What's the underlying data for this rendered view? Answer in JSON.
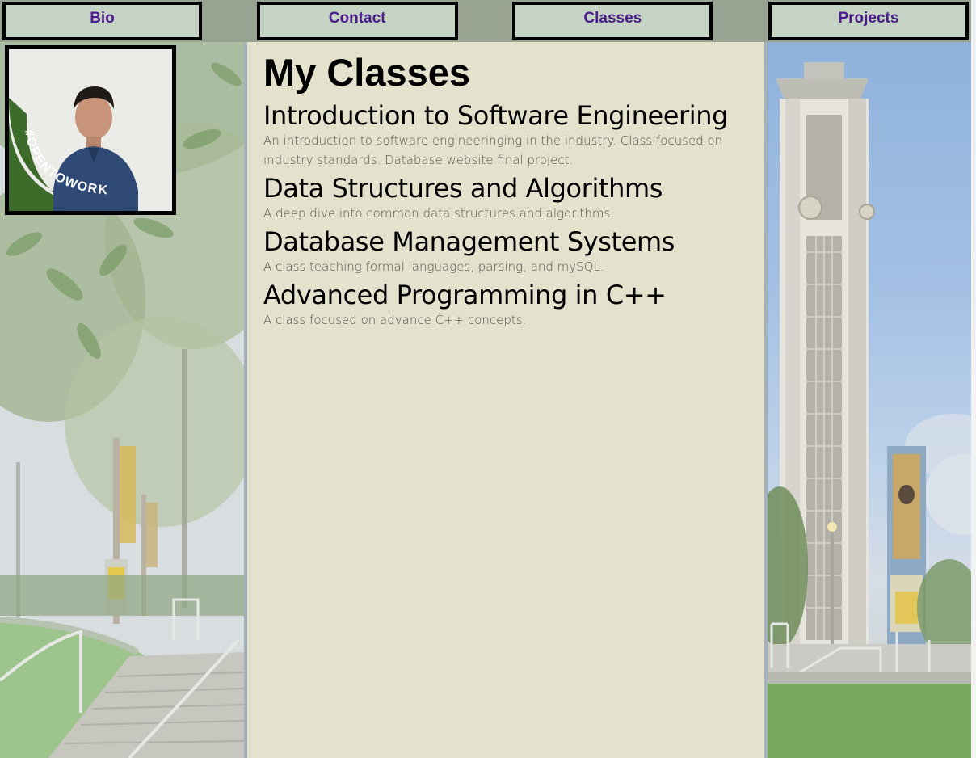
{
  "nav": {
    "items": [
      {
        "label": "Bio"
      },
      {
        "label": "Contact"
      },
      {
        "label": "Classes"
      },
      {
        "label": "Projects"
      }
    ]
  },
  "profile": {
    "badge_text": "#OPENTOWORK"
  },
  "main": {
    "title": "My Classes",
    "classes": [
      {
        "name": "Introduction to Software Engineering",
        "description": "An introduction to software engineeringing in the industry. Class focused on industry standards. Database website final project."
      },
      {
        "name": "Data Structures and Algorithms",
        "description": "A deep dive into common data structures and algorithms."
      },
      {
        "name": "Database Management Systems",
        "description": "A class teaching formal languages, parsing, and mySQL."
      },
      {
        "name": "Advanced Programming in C++",
        "description": "A class focused on advance C++ concepts."
      }
    ]
  },
  "colors": {
    "nav_bar": "#99a392",
    "nav_button": "#c6d4c5",
    "nav_text": "#4b1a8c",
    "content_bg": "#e4e1cc",
    "badge_green": "#3d6b2a"
  }
}
